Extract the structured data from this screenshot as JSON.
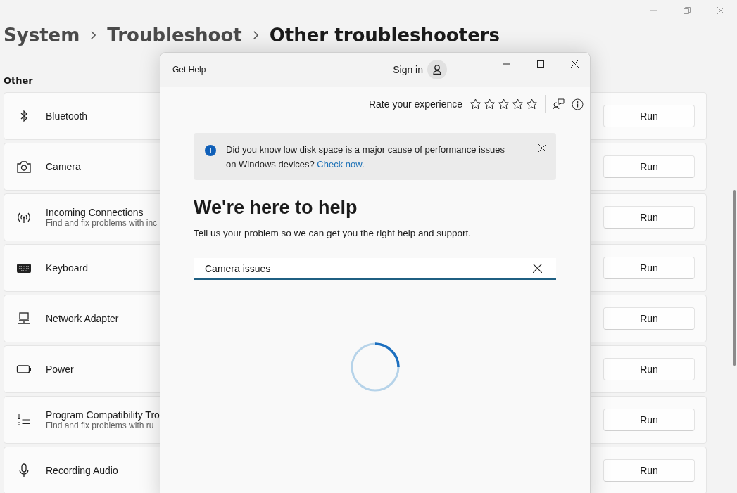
{
  "settings": {
    "breadcrumb": [
      "System",
      "Troubleshoot",
      "Other troubleshooters"
    ],
    "section": "Other",
    "items": [
      {
        "name": "Bluetooth",
        "action": "Run"
      },
      {
        "name": "Camera",
        "action": "Run"
      },
      {
        "name": "Incoming Connections",
        "description": "Find and fix problems with inc",
        "action": "Run"
      },
      {
        "name": "Keyboard",
        "action": "Run"
      },
      {
        "name": "Network Adapter",
        "action": "Run"
      },
      {
        "name": "Power",
        "action": "Run"
      },
      {
        "name": "Program Compatibility Tro",
        "description": "Find and fix problems with ru",
        "action": "Run"
      },
      {
        "name": "Recording Audio",
        "action": "Run"
      }
    ]
  },
  "dialog": {
    "title": "Get Help",
    "sign_in": "Sign in",
    "rating": {
      "label": "Rate your experience",
      "stars": 0
    },
    "banner": {
      "text": "Did you know low disk space is a major cause of performance issues on Windows devices?",
      "link": "Check now."
    },
    "heading": "We're here to help",
    "subtitle": "Tell us your problem so we can get you the right help and support.",
    "search": {
      "value": "Camera issues"
    },
    "loading": true
  }
}
